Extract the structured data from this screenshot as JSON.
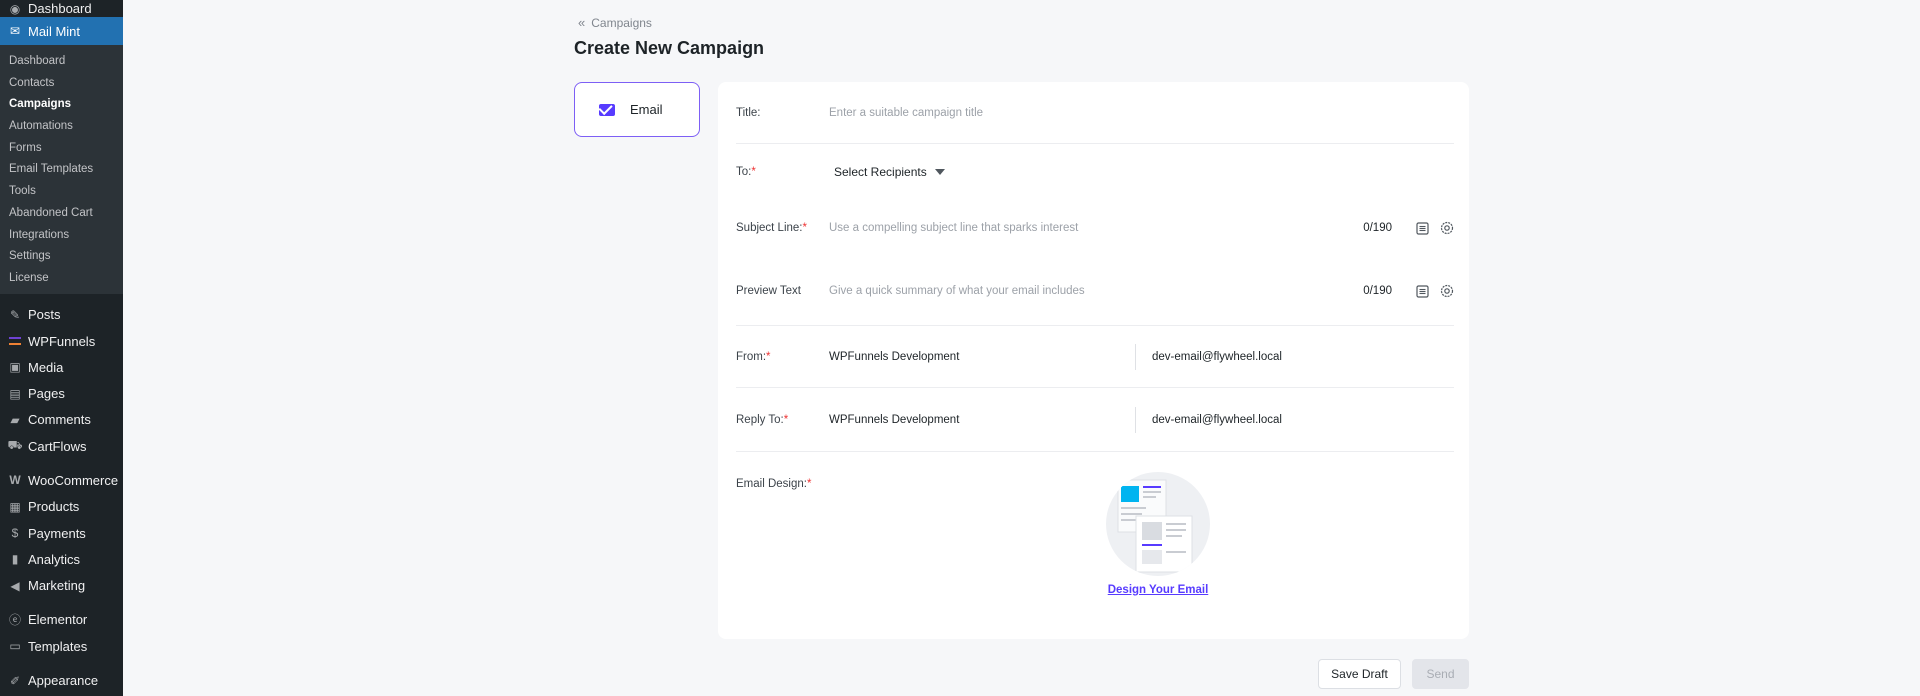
{
  "sidebar": {
    "top_items": [
      {
        "label": "Dashboard",
        "icon": "dashboard-icon"
      },
      {
        "label": "Mail Mint",
        "icon": "mail-icon",
        "active": true
      }
    ],
    "submenu": [
      "Dashboard",
      "Contacts",
      "Campaigns",
      "Automations",
      "Forms",
      "Email Templates",
      "Tools",
      "Abandoned Cart",
      "Integrations",
      "Settings",
      "License"
    ],
    "submenu_current": "Campaigns",
    "items": [
      {
        "label": "Posts",
        "icon": "pin-icon"
      },
      {
        "label": "WPFunnels",
        "icon": "wpfunnels-icon"
      },
      {
        "label": "Media",
        "icon": "media-icon"
      },
      {
        "label": "Pages",
        "icon": "pages-icon"
      },
      {
        "label": "Comments",
        "icon": "comments-icon"
      },
      {
        "label": "CartFlows",
        "icon": "cartflows-icon"
      },
      {
        "label": "WooCommerce",
        "icon": "woocommerce-icon"
      },
      {
        "label": "Products",
        "icon": "products-icon"
      },
      {
        "label": "Payments",
        "icon": "payments-icon"
      },
      {
        "label": "Analytics",
        "icon": "analytics-icon"
      },
      {
        "label": "Marketing",
        "icon": "marketing-icon"
      },
      {
        "label": "Elementor",
        "icon": "elementor-icon"
      },
      {
        "label": "Templates",
        "icon": "templates-icon"
      },
      {
        "label": "Appearance",
        "icon": "appearance-icon"
      }
    ]
  },
  "header": {
    "breadcrumb": "Campaigns",
    "title": "Create New Campaign"
  },
  "campaign_type": {
    "label": "Email"
  },
  "form": {
    "title": {
      "label": "Title:",
      "placeholder": "Enter a suitable campaign title"
    },
    "to": {
      "label": "To:",
      "required": "*",
      "value": "Select Recipients"
    },
    "subject": {
      "label": "Subject Line:",
      "required": "*",
      "placeholder": "Use a compelling subject line that sparks interest",
      "counter": "0/190"
    },
    "preview": {
      "label": "Preview Text",
      "placeholder": "Give a quick summary of what your email includes",
      "counter": "0/190"
    },
    "from": {
      "label": "From:",
      "required": "*",
      "name": "WPFunnels Development",
      "email": "dev-email@flywheel.local"
    },
    "reply_to": {
      "label": "Reply To:",
      "required": "*",
      "name": "WPFunnels Development",
      "email": "dev-email@flywheel.local"
    },
    "design": {
      "label": "Email Design:",
      "required": "*",
      "link": "Design Your Email"
    }
  },
  "actions": {
    "save_draft": "Save Draft",
    "send": "Send"
  },
  "colors": {
    "accent": "#573bff",
    "sidebar_bg": "#1d2327",
    "active_bg": "#2271b1",
    "required": "#ee3333"
  }
}
